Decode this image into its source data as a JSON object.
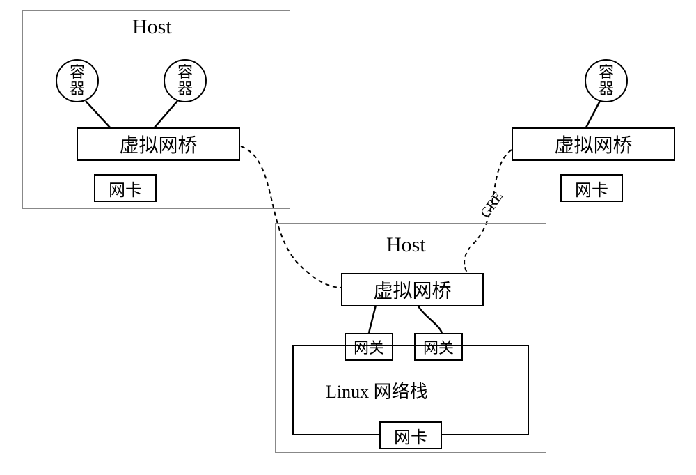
{
  "host1": {
    "label": "Host"
  },
  "host2": {
    "label": "Host"
  },
  "container": "容\n器",
  "bridge": "虚拟网桥",
  "nic": "网卡",
  "gateway": "网关",
  "linux_stack": "Linux 网络栈",
  "gre": "GRE"
}
